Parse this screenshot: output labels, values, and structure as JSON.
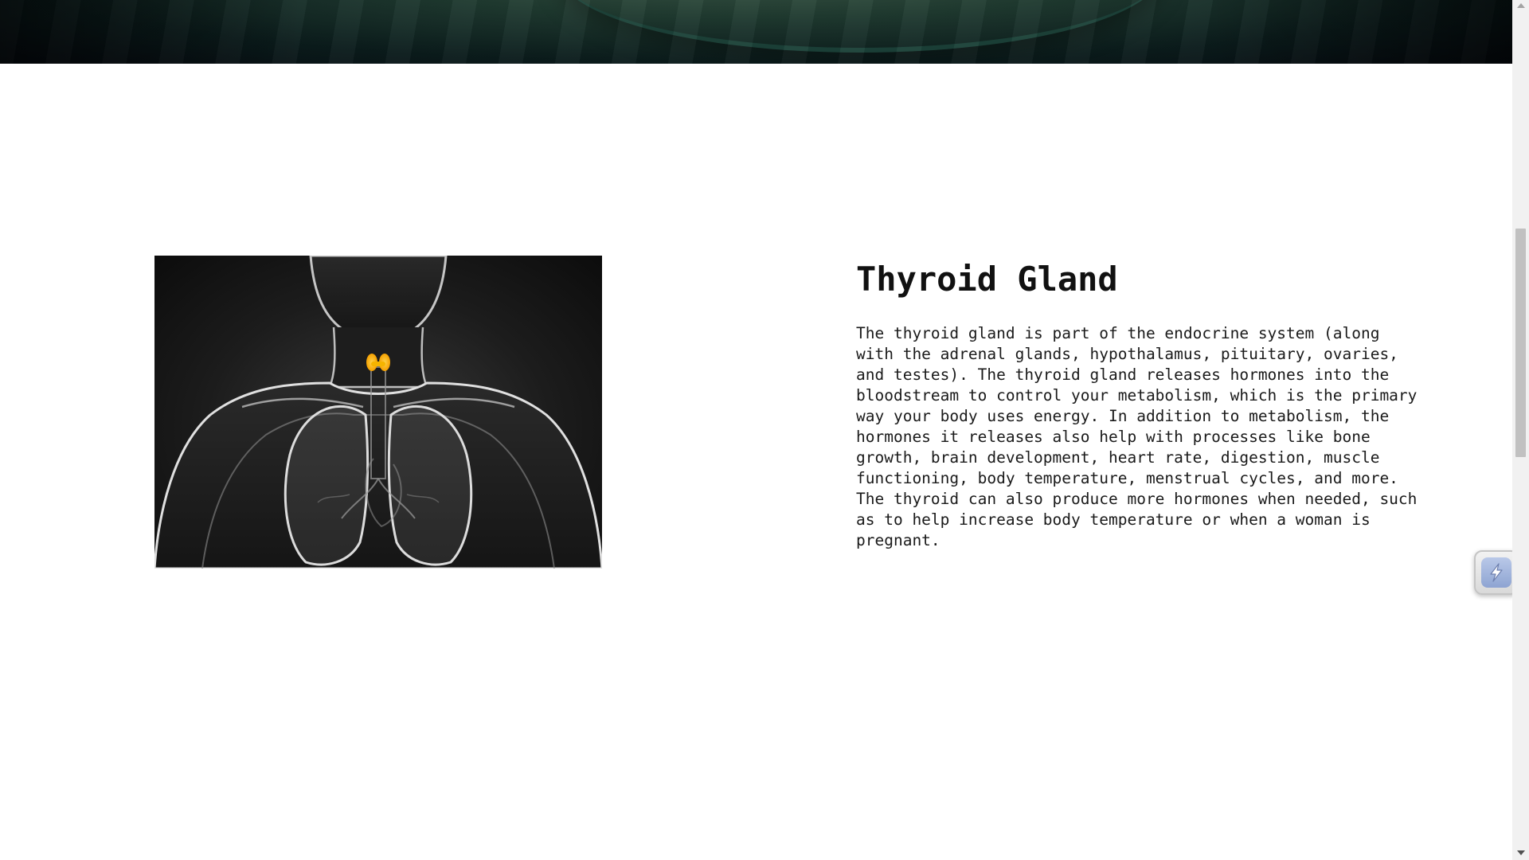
{
  "section": {
    "title": "Thyroid Gland",
    "body": "The thyroid gland is part of the endocrine system (along with the adrenal glands, hypothalamus, pituitary, ovaries, and testes). The thyroid gland releases hormones into the bloodstream to control your metabolism, which is the primary way your body uses energy. In addition to metabolism, the hormones it releases also help with processes like bone growth, brain development, heart rate, digestion, muscle functioning, body temperature, menstrual cycles, and more. The thyroid can also produce more hormones when needed, such as to help increase body temperature or when a woman is pregnant.",
    "image_icon": "human-chest-thyroid-illustration"
  },
  "widget": {
    "icon": "lightning-slash-icon"
  },
  "scrollbar": {
    "up_icon": "chevron-up-icon",
    "down_icon": "chevron-down-icon"
  },
  "colors": {
    "text": "#111111",
    "thyroid_highlight": "#f5b400",
    "hero_dark": "#0b1c1c"
  }
}
